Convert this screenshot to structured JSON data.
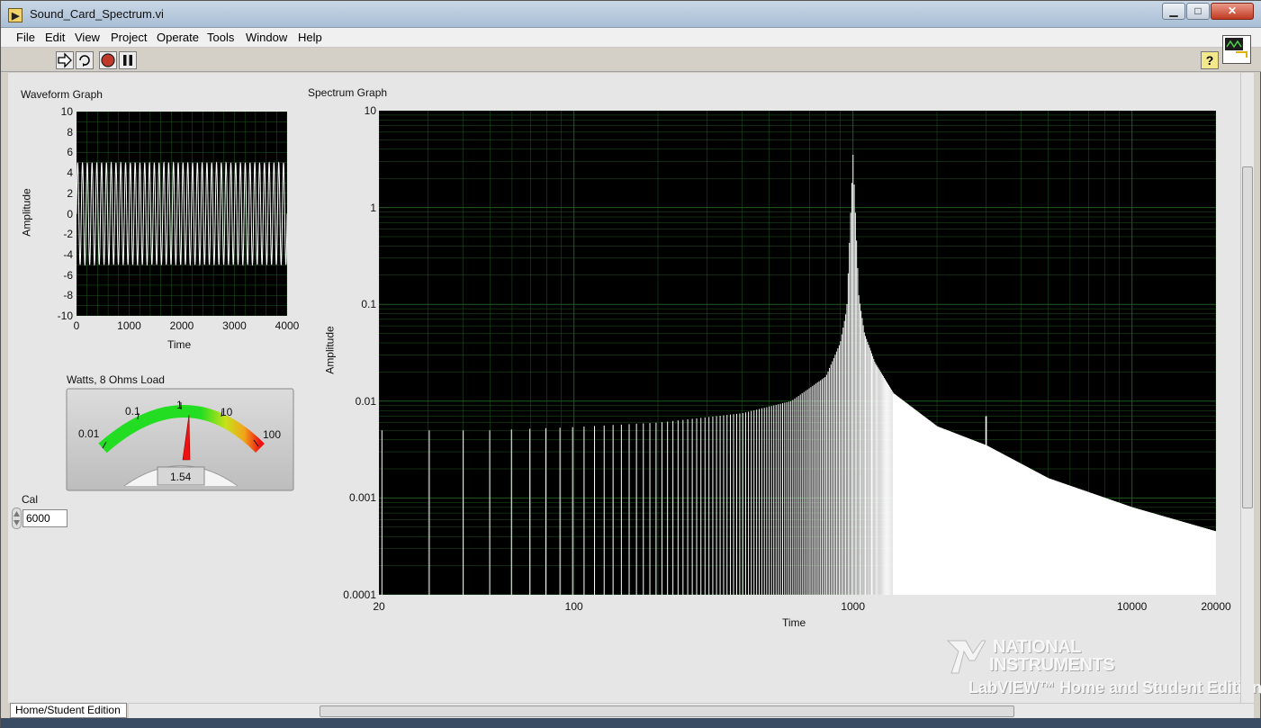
{
  "window": {
    "title": "Sound_Card_Spectrum.vi",
    "min": "▁",
    "max": "□",
    "close": "✕"
  },
  "menu": [
    "File",
    "Edit",
    "View",
    "Project",
    "Operate",
    "Tools",
    "Window",
    "Help"
  ],
  "toolbar": {
    "help": "?"
  },
  "waveform": {
    "label": "Waveform Graph",
    "ylabel": "Amplitude",
    "xlabel": "Time",
    "yticks": [
      "10",
      "8",
      "6",
      "4",
      "2",
      "0",
      "-2",
      "-4",
      "-6",
      "-8",
      "-10"
    ],
    "xticks": [
      "0",
      "1000",
      "2000",
      "3000",
      "4000"
    ]
  },
  "meter": {
    "label": "Watts, 8 Ohms Load",
    "scale": [
      "0.01",
      "0.1",
      "1",
      "10",
      "100"
    ],
    "value": "1.54"
  },
  "cal": {
    "label": "Cal",
    "value": "6000"
  },
  "spectrum": {
    "label": "Spectrum Graph",
    "ylabel": "Amplitude",
    "xlabel": "Time",
    "yticks": [
      "10",
      "1",
      "0.1",
      "0.01",
      "0.001",
      "0.0001"
    ],
    "xticks": [
      "20",
      "100",
      "1000",
      "10000",
      "20000"
    ]
  },
  "chart_data": [
    {
      "type": "line",
      "title": "Waveform Graph",
      "xlabel": "Time",
      "ylabel": "Amplitude",
      "xlim": [
        0,
        4000
      ],
      "ylim": [
        -10,
        10
      ],
      "series": [
        {
          "description_amplitude_pp": [
            -5,
            5
          ],
          "cycles": 44
        }
      ],
      "grid": true
    },
    {
      "type": "line",
      "title": "Spectrum Graph",
      "xlabel": "Time",
      "ylabel": "Amplitude",
      "x_scale": "log",
      "y_scale": "log",
      "xlim": [
        20,
        20000
      ],
      "ylim": [
        0.0001,
        10
      ],
      "x": [
        20,
        30,
        50,
        100,
        200,
        400,
        600,
        800,
        900,
        950,
        1000,
        1050,
        1100,
        1200,
        1400,
        2000,
        3000,
        5000,
        10000,
        20000
      ],
      "values": [
        0.005,
        0.005,
        0.005,
        0.0054,
        0.006,
        0.0075,
        0.01,
        0.018,
        0.04,
        0.09,
        3.5,
        0.12,
        0.05,
        0.025,
        0.012,
        0.0055,
        0.0035,
        0.0016,
        0.0008,
        0.00045
      ],
      "peaks": [
        {
          "x": 1000,
          "y": 3.5
        },
        {
          "x": 3000,
          "y": 0.007
        }
      ],
      "grid": true
    }
  ],
  "status": {
    "edition_tab": "Home/Student Edition"
  },
  "logo": {
    "line1": "NATIONAL",
    "line2": "INSTRUMENTS",
    "edition": "LabVIEW™ Home and Student Edition"
  },
  "colors": {
    "plot_bg": "#000000",
    "grid": "#1f5a1f",
    "trace": "#ffffff",
    "meter_green": "#22dd22",
    "meter_red": "#ee1111"
  }
}
